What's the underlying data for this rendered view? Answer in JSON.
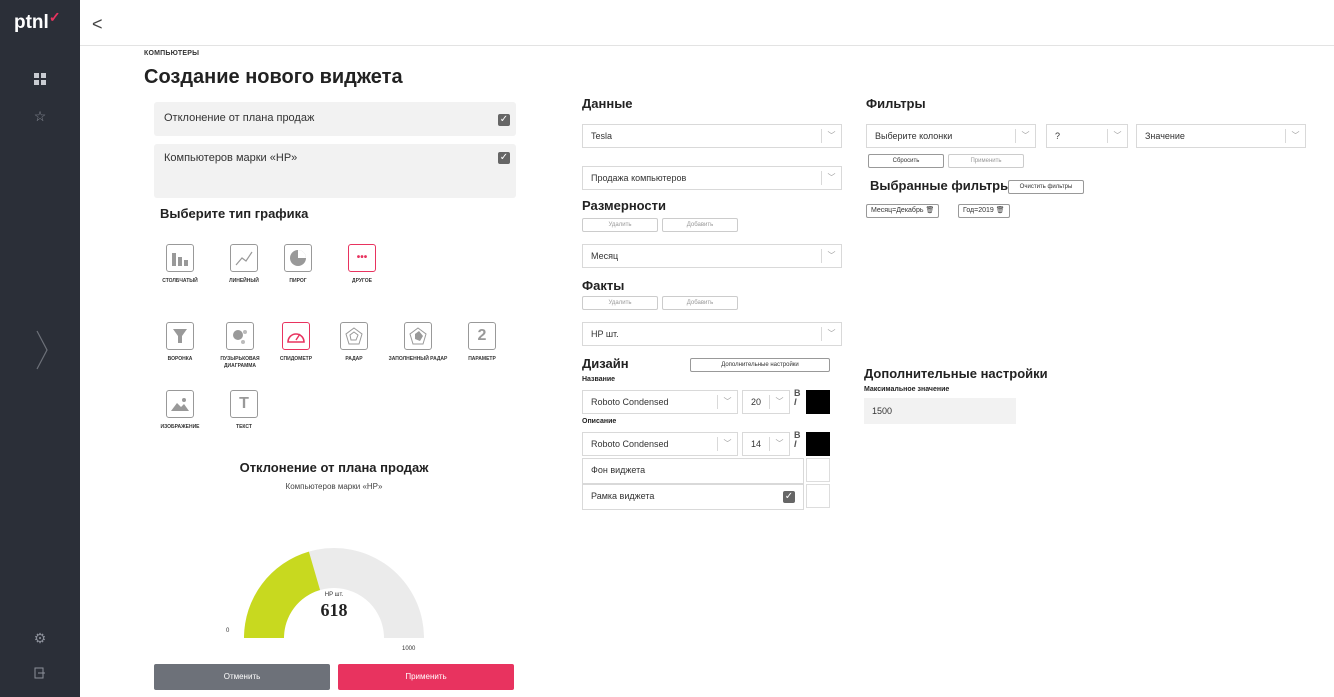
{
  "sidebar": {
    "logo_text": "ptnl",
    "logo_mark": "✓",
    "icons": [
      "dashboard-icon",
      "star-icon",
      "chevron-right-icon",
      "settings-icon",
      "logout-icon"
    ]
  },
  "header": {
    "back_glyph": "<"
  },
  "breadcrumb": "КОМПЬЮТЕРЫ",
  "page_title": "Создание нового виджета",
  "widget": {
    "title_value": "Отклонение от плана продаж",
    "description_value": "Компьютеров марки «HP»"
  },
  "chart_type": {
    "heading": "Выберите тип графика",
    "items": [
      {
        "label": "СТОЛБЧАТЫЙ",
        "icon": "bar-chart-icon"
      },
      {
        "label": "ЛИНЕЙНЫЙ",
        "icon": "line-chart-icon"
      },
      {
        "label": "ПИРОГ",
        "icon": "pie-chart-icon"
      },
      {
        "label": "ДРУГОЕ",
        "icon": "more-icon"
      },
      {
        "label": "ВОРОНКА",
        "icon": "funnel-icon"
      },
      {
        "label": "ПУЗЫРЬКОВАЯ ДИАГРАММА",
        "icon": "bubble-chart-icon"
      },
      {
        "label": "СПИДОМЕТР",
        "icon": "speedometer-icon"
      },
      {
        "label": "РАДАР",
        "icon": "radar-icon"
      },
      {
        "label": "ЗАПОЛНЕННЫЙ РАДАР",
        "icon": "filled-radar-icon"
      },
      {
        "label": "ПАРАМЕТР",
        "icon": "parameter-icon"
      },
      {
        "label": "ИЗОБРАЖЕНИЕ",
        "icon": "image-icon"
      },
      {
        "label": "ТЕКСТ",
        "icon": "text-icon"
      }
    ],
    "selected": "СПИДОМЕТР",
    "icon_glyphs": {
      "parameter": "2",
      "text": "T",
      "more": "•••"
    }
  },
  "preview": {
    "title": "Отклонение от плана продаж",
    "subtitle": "Компьютеров марки «HP»",
    "gauge_label": "HP шт.",
    "gauge_value": "618",
    "gauge_min": "0",
    "gauge_max": "1000",
    "gauge_fraction": 0.41,
    "fill_color": "#c8d91f",
    "track_color": "#ebebeb"
  },
  "buttons": {
    "cancel": "Отменить",
    "apply": "Применить",
    "cancel_color": "#6d7179",
    "apply_color": "#e8335f"
  },
  "data_section": {
    "heading": "Данные",
    "source_value": "Tesla",
    "dataset_value": "Продажа компьютеров"
  },
  "dimensions": {
    "heading": "Размерности",
    "delete_label": "Удалить",
    "add_label": "Добавить",
    "value": "Месяц"
  },
  "facts": {
    "heading": "Факты",
    "delete_label": "Удалить",
    "add_label": "Добавить",
    "value": "HP шт."
  },
  "design": {
    "heading": "Дизайн",
    "extra_settings_button": "Дополнительные настройки",
    "name_label": "Название",
    "name_font": "Roboto Condensed",
    "name_size": "20",
    "desc_label": "Описание",
    "desc_font": "Roboto Condensed",
    "desc_size": "14",
    "bold_glyph": "B",
    "italic_glyph": "I",
    "color_black": "#000000",
    "bg_label": "Фон виджета",
    "frame_label": "Рамка виджета"
  },
  "filters": {
    "heading": "Фильтры",
    "column_placeholder": "Выберите колонки",
    "operator_value": "?",
    "value_placeholder": "Значение",
    "reset_label": "Сбросить",
    "apply_label": "Применить",
    "selected_heading": "Выбранные фильтры",
    "clear_label": "Очистить фильтры",
    "chips": [
      "Месяц=Декабрь",
      "Год=2019"
    ]
  },
  "extra_settings": {
    "heading": "Дополнительные настройки",
    "max_label": "Максимальное значение",
    "max_value": "1500"
  }
}
